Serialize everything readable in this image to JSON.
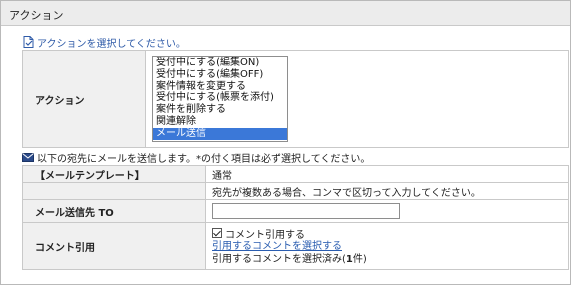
{
  "panel": {
    "title": "アクション"
  },
  "action_hint": "アクションを選択してください。",
  "action_row": {
    "label": "アクション",
    "options": [
      "受付中にする(編集ON)",
      "受付中にする(編集OFF)",
      "案件情報を変更する",
      "受付中にする(帳票を添付)",
      "案件を削除する",
      "関連解除",
      "メール送信"
    ],
    "selected": "メール送信"
  },
  "mail_hint": "以下の宛先にメールを送信します。*の付く項目は必ず選択してください。",
  "template_row": {
    "label": "【メールテンプレート】",
    "value": "通常"
  },
  "note_row": {
    "text": "宛先が複数ある場合、コンマで区切って入力してください。"
  },
  "to_row": {
    "label": "メール送信先 TO",
    "value": ""
  },
  "comment_row": {
    "label": "コメント引用",
    "checkbox_label": "コメント引用する",
    "checked": true,
    "link_text": "引用するコメントを選択する",
    "count_prefix": "引用するコメントを選択済み(",
    "count": "1",
    "count_suffix": "件)"
  },
  "colors": {
    "link": "#2a5db0",
    "hint": "#2f5ba8",
    "selected_bg": "#3b78d8"
  }
}
